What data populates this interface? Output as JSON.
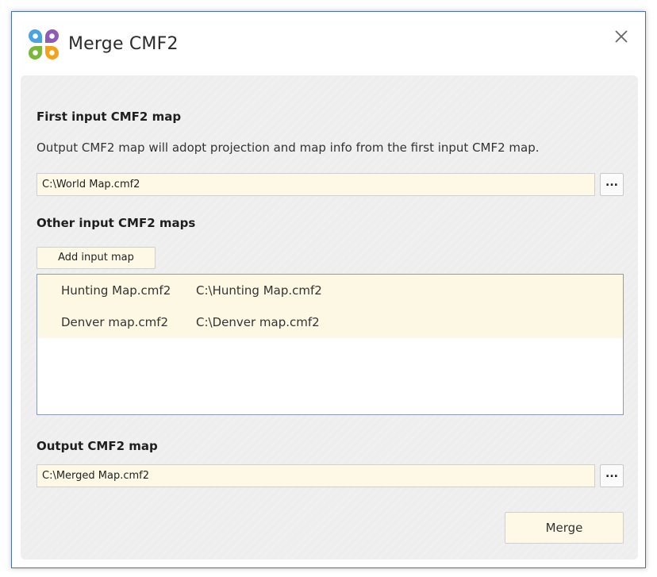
{
  "window": {
    "title": "Merge CMF2"
  },
  "first_input": {
    "label": "First input CMF2 map",
    "description": "Output CMF2 map will adopt projection and map info from the first input CMF2 map.",
    "path": "C:\\World Map.cmf2",
    "browse_label": "..."
  },
  "other_inputs": {
    "label": "Other input CMF2 maps",
    "add_button_label": "Add input map",
    "items": [
      {
        "name": "Hunting Map.cmf2",
        "path": "C:\\Hunting Map.cmf2"
      },
      {
        "name": "Denver map.cmf2",
        "path": "C:\\Denver map.cmf2"
      }
    ]
  },
  "output": {
    "label": "Output CMF2 map",
    "path": "C:\\Merged Map.cmf2",
    "browse_label": "..."
  },
  "merge_button_label": "Merge",
  "icons": {
    "logo": "app-logo-icon",
    "close": "close-icon"
  },
  "colors": {
    "accent_border": "#4a6fb3",
    "input_background": "#fdf9e6",
    "row_highlight": "#fdf8e4",
    "panel_background": "#eeeeee",
    "logo_blue": "#4aa3df",
    "logo_purple": "#8e5bb5",
    "logo_green": "#7ab83a",
    "logo_orange": "#f3a31b"
  }
}
